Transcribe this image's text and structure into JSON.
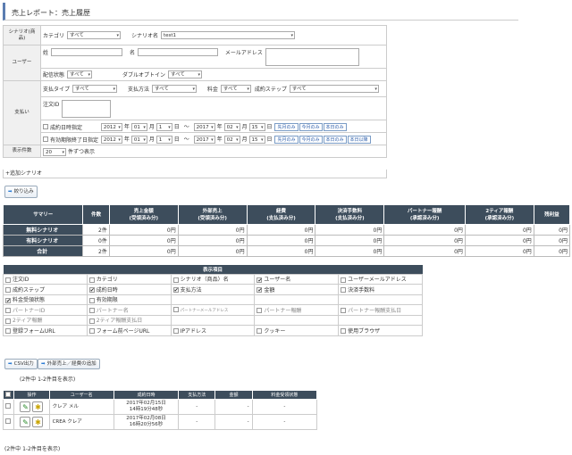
{
  "page": {
    "title": "売上レポート：売上履歴"
  },
  "filters": {
    "scenario_header": "シナリオ(商品)",
    "category_label": "カテゴリ",
    "category_value": "すべて",
    "scenario_name_label": "シナリオ名",
    "scenario_name_value": "test1",
    "user_header": "ユーザー",
    "last_name_label": "姓",
    "first_name_label": "名",
    "email_label": "メールアドレス",
    "delivery_label": "配信状態",
    "delivery_value": "すべて",
    "double_optin_label": "ダブルオプトイン",
    "double_optin_value": "すべて",
    "payment_header": "支払い",
    "pay_type_label": "支払タイプ",
    "pay_type_value": "すべて",
    "pay_method_label": "支払方法",
    "pay_method_value": "すべて",
    "fee_label": "料金",
    "fee_value": "すべて",
    "step_label": "成約ステップ",
    "step_value": "すべて",
    "order_id_label": "注文ID",
    "date_contract_label": "成約日時指定",
    "date_expire_label": "有効期限終了日指定",
    "date_from": {
      "year": "2012",
      "month": "01",
      "day": "1"
    },
    "date_to": {
      "year": "2017",
      "month": "02",
      "day": "15"
    },
    "year_unit": "年",
    "month_unit": "月",
    "day_unit": "日",
    "range_sep": "～",
    "btn_this_month": "先月のみ",
    "btn_today": "今月のみ",
    "btn_period": "本日のみ",
    "btn_period2": "本日以降",
    "row_count_label": "表示件数",
    "row_count_value": "20",
    "row_count_suffix": "件ずつ表示",
    "add_scenario": "+追加シナリオ"
  },
  "filter_button": "絞り込み",
  "summary": {
    "headers": [
      "サマリー",
      "件数",
      "売上金額\n(受領済み分)",
      "外部売上\n(受領済み分)",
      "経費\n(支払済み分)",
      "決済手数料\n(支払済み分)",
      "パートナー報酬\n(承認済み分)",
      "2ティア報酬\n(承認済み分)",
      "残利益"
    ],
    "rows": [
      {
        "label": "無料シナリオ",
        "values": [
          "2件",
          "0円",
          "0円",
          "0円",
          "0円",
          "0円",
          "0円",
          "0円"
        ]
      },
      {
        "label": "有料シナリオ",
        "values": [
          "0件",
          "0円",
          "0円",
          "0円",
          "0円",
          "0円",
          "0円",
          "0円"
        ]
      },
      {
        "label": "合計",
        "values": [
          "2件",
          "0円",
          "0円",
          "0円",
          "0円",
          "0円",
          "0円",
          "0円"
        ]
      }
    ]
  },
  "display_items": {
    "header": "表示項目",
    "rows": [
      [
        {
          "t": "注文ID",
          "c": false
        },
        {
          "t": "カテゴリ",
          "c": false
        },
        {
          "t": "シナリオ（商品）名",
          "c": false
        },
        {
          "t": "ユーザー名",
          "c": true
        },
        {
          "t": "ユーザーメールアドレス",
          "c": false
        }
      ],
      [
        {
          "t": "成約ステップ",
          "c": false
        },
        {
          "t": "成約日時",
          "c": true
        },
        {
          "t": "支払方法",
          "c": true
        },
        {
          "t": "金額",
          "c": true
        },
        {
          "t": "決済手数料",
          "c": false
        }
      ],
      [
        {
          "t": "料金受領状態",
          "c": true
        },
        {
          "t": "有効期限",
          "c": false
        },
        {
          "t": "",
          "c": null
        },
        {
          "t": "",
          "c": null
        },
        {
          "t": "",
          "c": null
        }
      ],
      [
        {
          "t": "パートナーID",
          "c": false,
          "d": true
        },
        {
          "t": "パートナー名",
          "c": false,
          "d": true
        },
        {
          "t": "パートナーメールアドレス",
          "c": false,
          "d": true
        },
        {
          "t": "パートナー報酬",
          "c": false,
          "d": true
        },
        {
          "t": "パートナー報酬支払日",
          "c": false,
          "d": true
        }
      ],
      [
        {
          "t": "2ティア報酬",
          "c": false,
          "d": true
        },
        {
          "t": "2ティア報酬支払日",
          "c": false,
          "d": true
        },
        {
          "t": "",
          "c": null
        },
        {
          "t": "",
          "c": null
        },
        {
          "t": "",
          "c": null
        }
      ],
      [
        {
          "t": "登録フォームURL",
          "c": false
        },
        {
          "t": "フォーム前ページURL",
          "c": false
        },
        {
          "t": "IPアドレス",
          "c": false
        },
        {
          "t": "クッキー",
          "c": false
        },
        {
          "t": "使用ブラウザ",
          "c": false
        }
      ]
    ]
  },
  "csv_button": "CSV出力",
  "external_button": "外部売上／経費の追加",
  "count_text_top": "(2件中 1-2件目を表示)",
  "count_text_bottom": "(2件中 1-2件目を表示)",
  "results": {
    "headers": [
      "操作",
      "ユーザー名",
      "成約日時",
      "支払方法",
      "金額",
      "料金受領状態"
    ],
    "rows": [
      {
        "user": "クレア メル",
        "date": "2017年02月15日",
        "time": "14時19分48秒",
        "method": "-",
        "amount": "-",
        "status": "-"
      },
      {
        "user": "CREA クレア",
        "date": "2017年02月08日",
        "time": "16時20分56秒",
        "method": "-",
        "amount": "-",
        "status": "-"
      }
    ]
  },
  "colors": {
    "header_bg": "#3d4d5c",
    "accent": "#5b7db1",
    "button_text": "#2a5caa"
  }
}
